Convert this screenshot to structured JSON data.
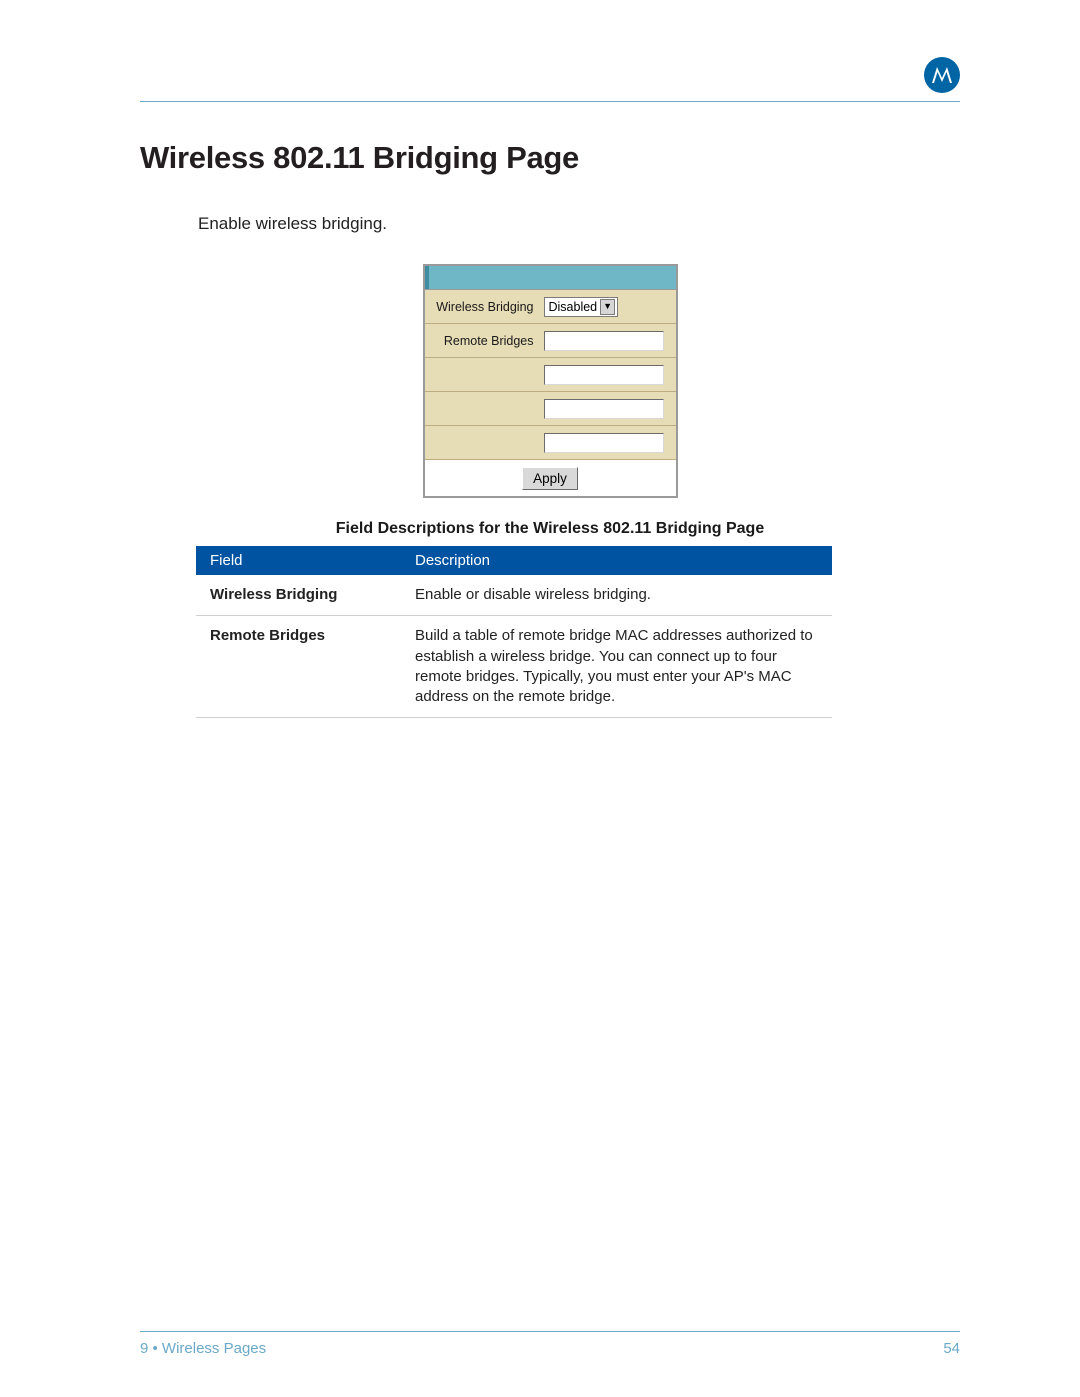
{
  "page": {
    "title": "Wireless 802.11 Bridging Page",
    "intro": "Enable wireless bridging."
  },
  "form": {
    "wireless_bridging_label": "Wireless Bridging",
    "wireless_bridging_value": "Disabled",
    "remote_bridges_label": "Remote Bridges",
    "apply_label": "Apply"
  },
  "subhead": "Field Descriptions for the Wireless 802.11 Bridging Page",
  "table": {
    "head_field": "Field",
    "head_desc": "Description",
    "rows": [
      {
        "field": "Wireless Bridging",
        "desc": "Enable or disable wireless bridging."
      },
      {
        "field": "Remote Bridges",
        "desc": "Build a table of remote bridge MAC addresses authorized to establish a wireless bridge. You can connect up to four remote bridges. Typically, you must enter your AP's MAC address on the remote bridge."
      }
    ]
  },
  "footer": {
    "left": "9 • Wireless Pages",
    "right": "54"
  }
}
